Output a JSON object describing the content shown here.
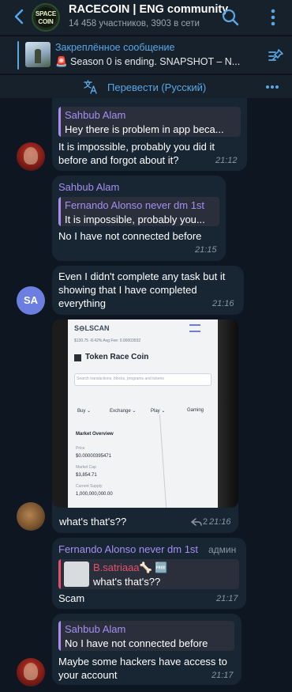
{
  "header": {
    "title": "RACECOIN | ENG community",
    "subtitle": "14 458 участников, 3903 в сети",
    "avatar_text_1": "SPACE",
    "avatar_text_2": "COIN"
  },
  "pinned": {
    "title": "Закреплённое сообщение",
    "text": "🚨 Season 0 is ending. SNAPSHOT – N..."
  },
  "translate": {
    "label": "Перевести (Русский)"
  },
  "messages": [
    {
      "reply_name": "Sahbub Alam",
      "reply_text": "Hey there is problem in app beca...",
      "lines": [
        "It is impossible, probably you did it",
        "before and forgot about it?"
      ],
      "time": "21:12"
    },
    {
      "name": "Sahbub Alam",
      "reply_name": "Fernando Alonso never dm 1st",
      "reply_text": "It is impossible, probably you...",
      "lines": [
        "No I have not connected before"
      ],
      "time": "21:15"
    },
    {
      "avatar_initials": "SA",
      "lines": [
        "Even I didn't complete any task but it",
        "showing that I have completed",
        "everything"
      ],
      "time": "21:16"
    },
    {
      "photo": {
        "brand": "S⊖LSCAN",
        "price_line": "$130.75  -8.42%    Avg Fee: 0.00003932",
        "token_title": "Token Race Coin",
        "search_placeholder": "Search transactions, blocks, programs and tokens",
        "menu": [
          "Buy ⌄",
          "Exchange ⌄",
          "Play ⌄",
          "Gaming"
        ],
        "overview_title": "Market Overview",
        "price_label": "Price",
        "price_value": "$0.00000395471",
        "cap_label": "Market Cap",
        "cap_value": "$3,854.71",
        "supply_label": "Current Supply",
        "supply_value": "1,000,000,000.00"
      },
      "lines": [
        "what's that's??"
      ],
      "replies": "2",
      "time": "21:16"
    },
    {
      "name": "Fernando Alonso never dm 1st",
      "badge": "админ",
      "reply_name": "B.satriaaa🦴 🆓",
      "reply_text": "what's that's??",
      "lines": [
        "Scam"
      ],
      "time": "21:17"
    },
    {
      "reply_name": "Sahbub Alam",
      "reply_text": "No I have not connected before",
      "lines": [
        "Maybe some hackers have access to",
        "your account"
      ],
      "time": "21:17"
    }
  ]
}
